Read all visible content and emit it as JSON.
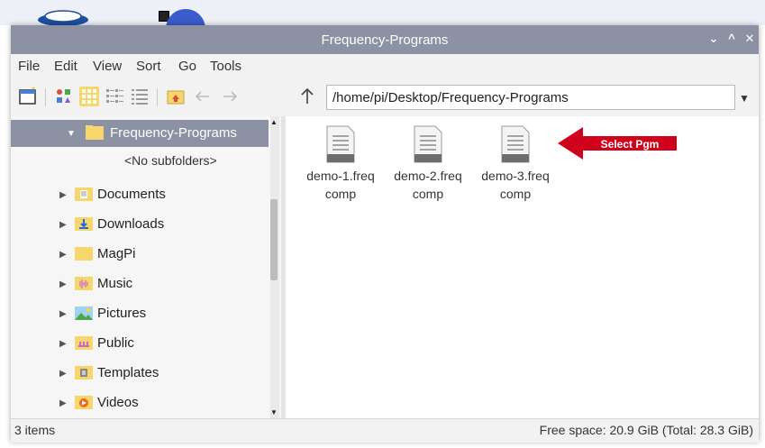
{
  "window": {
    "title": "Frequency-Programs"
  },
  "menu": [
    "File",
    "Edit",
    "View",
    "Sort",
    "Go",
    "Tools"
  ],
  "toolbar": {
    "path": "/home/pi/Desktop/Frequency-Programs"
  },
  "sidebar": {
    "selected": "Frequency-Programs",
    "no_subfolders": "<No subfolders>",
    "items": [
      "Documents",
      "Downloads",
      "MagPi",
      "Music",
      "Pictures",
      "Public",
      "Templates",
      "Videos"
    ]
  },
  "files": [
    {
      "line1": "demo-1.freq",
      "line2": "comp"
    },
    {
      "line1": "demo-2.freq",
      "line2": "comp"
    },
    {
      "line1": "demo-3.freq",
      "line2": "comp"
    }
  ],
  "annotation": {
    "text": "Select Pgm",
    "color": "#d0021b"
  },
  "status": {
    "items": "3 items",
    "free_space": "Free space: 20.9 GiB (Total: 28.3 GiB)"
  },
  "colors": {
    "titlebar": "#8c92a4",
    "folder": "#f7d66b"
  }
}
